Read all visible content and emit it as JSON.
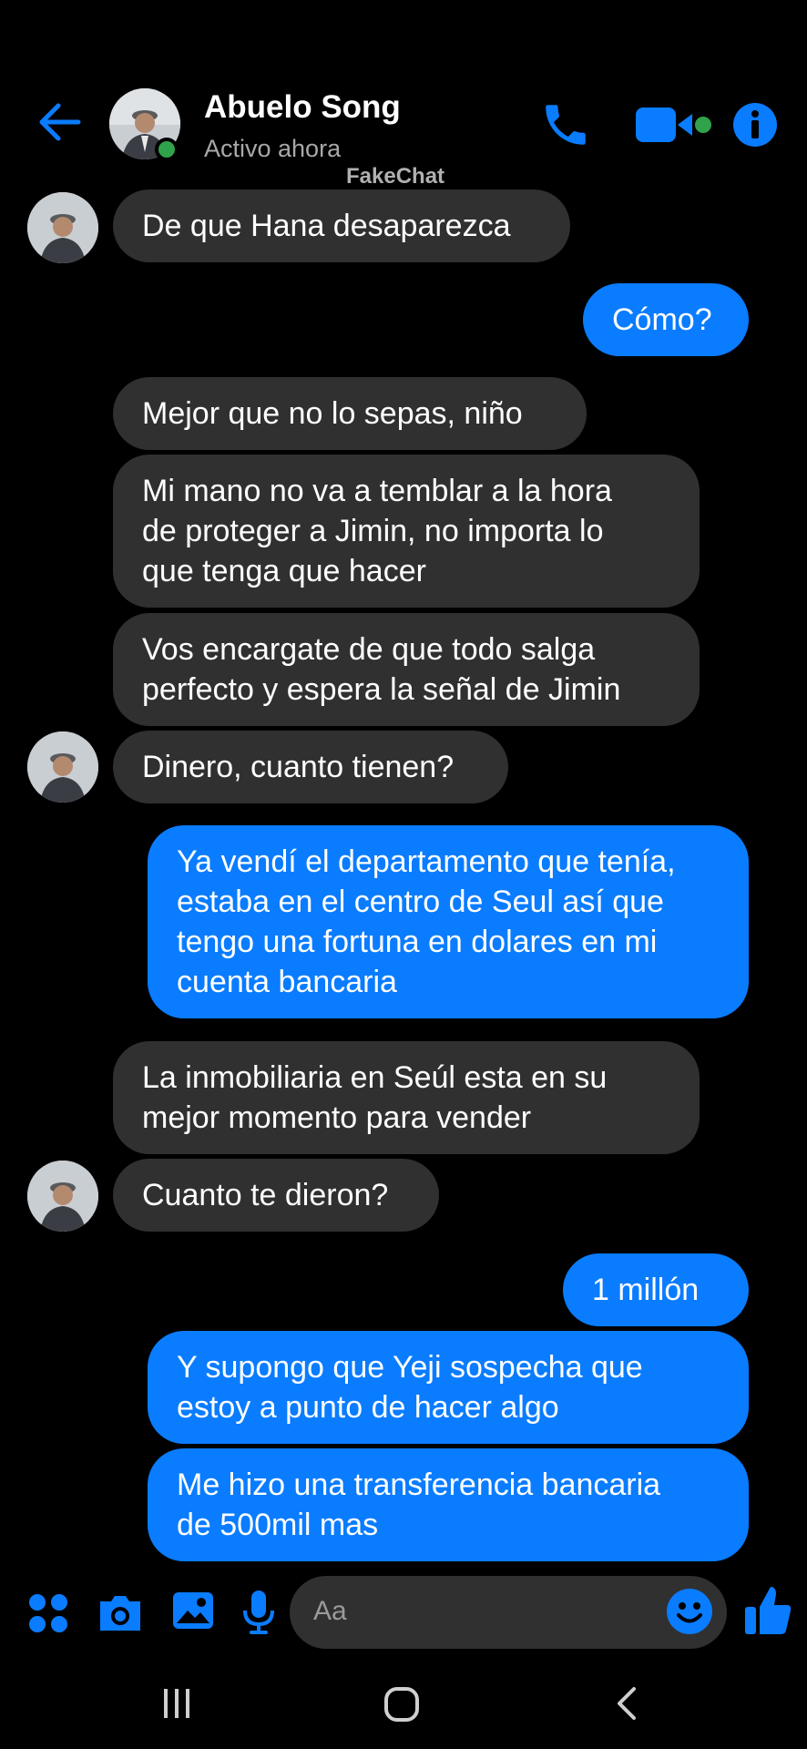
{
  "header": {
    "contact_name": "Abuelo Song",
    "status": "Activo ahora",
    "watermark": "FakeChat"
  },
  "colors": {
    "accent": "#0a7cff",
    "received_bubble": "#303030",
    "online": "#31a24c",
    "background": "#000000"
  },
  "messages": [
    {
      "side": "received",
      "text": "De que Hana desaparezca"
    },
    {
      "side": "sent",
      "text": "Cómo?"
    },
    {
      "side": "received",
      "text": "Mejor que no lo sepas, niño"
    },
    {
      "side": "received",
      "text": "Mi mano no va a temblar a la hora\nde proteger a Jimin, no importa lo\nque tenga que hacer"
    },
    {
      "side": "received",
      "text": "Vos encargate de que todo salga\nperfecto y espera la señal de Jimin"
    },
    {
      "side": "received",
      "text": "Dinero, cuanto tienen?"
    },
    {
      "side": "sent",
      "text": "Ya vendí el departamento que tenía,\nestaba en el centro de Seul así que\ntengo una fortuna en dolares en mi\ncuenta bancaria"
    },
    {
      "side": "received",
      "text": "La inmobiliaria en Seúl esta en su\nmejor momento para vender"
    },
    {
      "side": "received",
      "text": "Cuanto te dieron?"
    },
    {
      "side": "sent",
      "text": "1 millón"
    },
    {
      "side": "sent",
      "text": "Y supongo que Yeji sospecha que\nestoy a punto de hacer algo"
    },
    {
      "side": "sent",
      "text": "Me hizo una transferencia bancaria\nde 500mil mas"
    }
  ],
  "composer": {
    "placeholder": "Aa",
    "icons": [
      "menu-grid-icon",
      "camera-icon",
      "gallery-icon",
      "microphone-icon",
      "emoji-icon",
      "thumbs-up-icon"
    ]
  },
  "navbar": {
    "icons": [
      "recent-apps-icon",
      "home-icon",
      "back-icon"
    ]
  }
}
